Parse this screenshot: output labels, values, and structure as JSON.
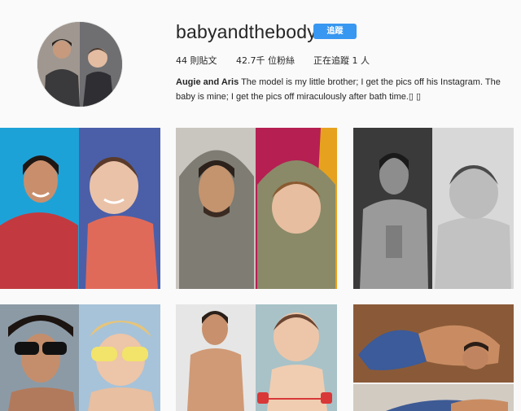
{
  "profile": {
    "username": "babyandthebody",
    "follow_label": "追蹤",
    "stats": {
      "posts": "44 則貼文",
      "followers": "42.7千 位粉絲",
      "following": "正在追蹤 1 人"
    },
    "bio_name": "Augie and Aris",
    "bio_text": "The model is my little brother; I get the pics off his Instagram. The baby is mine; I get the pics off miraculously after bath time.▯ ▯"
  },
  "colors": {
    "accent": "#3897f0",
    "background": "#fafafa"
  },
  "posts": [
    {
      "alt": "red sweater man and baby on blue"
    },
    {
      "alt": "hooded man and baby in hood"
    },
    {
      "alt": "black and white shirtless man and baby"
    },
    {
      "alt": "sunglasses man and baby"
    },
    {
      "alt": "shirtless man and baby with red"
    },
    {
      "alt": "lying man photo"
    }
  ]
}
